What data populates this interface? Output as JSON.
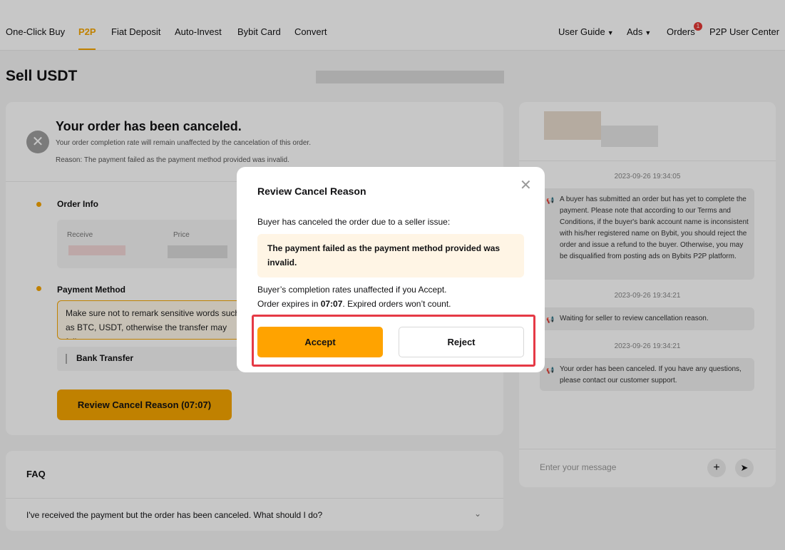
{
  "nav": {
    "items": [
      "One-Click Buy",
      "P2P",
      "Fiat Deposit",
      "Auto-Invest",
      "Bybit Card",
      "Convert"
    ],
    "right": {
      "user_guide": "User Guide",
      "ads": "Ads",
      "orders": "Orders",
      "orders_badge": "1",
      "user_center": "P2P User Center"
    }
  },
  "page": {
    "title": "Sell USDT"
  },
  "order": {
    "status_title": "Your order has been canceled.",
    "status_note": "Your order completion rate will remain unaffected by the cancelation of this order.",
    "reason": "Reason: The payment failed as the payment method provided was invalid.",
    "order_info_label": "Order Info",
    "receive_label": "Receive",
    "price_label": "Price",
    "payment_method_label": "Payment Method",
    "warning": "Make sure not to remark sensitive words such as BTC, USDT, otherwise the transfer may fail.",
    "bank_transfer": "Bank Transfer",
    "review_button": "Review Cancel Reason (07:07)"
  },
  "faq": {
    "title": "FAQ",
    "questions": [
      "I've received the payment but the order has been canceled. What should I do?"
    ]
  },
  "chat": {
    "messages": [
      {
        "time": "2023-09-26 19:34:05",
        "text": "A buyer has submitted an order but has yet to complete the payment. Please note that according to our Terms and Conditions, if the buyer's bank account name is inconsistent with his/her registered name on Bybit, you should reject the order and issue a refund to the buyer. Otherwise, you may be disqualified from posting ads on Bybits P2P platform."
      },
      {
        "time": "2023-09-26 19:34:21",
        "text": "Waiting for seller to review cancellation reason."
      },
      {
        "time": "2023-09-26 19:34:21",
        "text": "Your order has been canceled. If you have any questions, please contact our customer support."
      }
    ],
    "input_placeholder": "Enter your message"
  },
  "modal": {
    "title": "Review Cancel Reason",
    "intro": "Buyer has canceled the order due to a seller issue:",
    "reason": "The payment failed as the payment method provided was invalid.",
    "line1": "Buyer’s completion rates unaffected if you Accept.",
    "line2_prefix": "Order expires in ",
    "line2_time": "07:07",
    "line2_suffix": ". Expired orders won’t count.",
    "accept": "Accept",
    "reject": "Reject"
  },
  "colors": {
    "accent": "#f7a600",
    "highlight": "#e53945"
  }
}
